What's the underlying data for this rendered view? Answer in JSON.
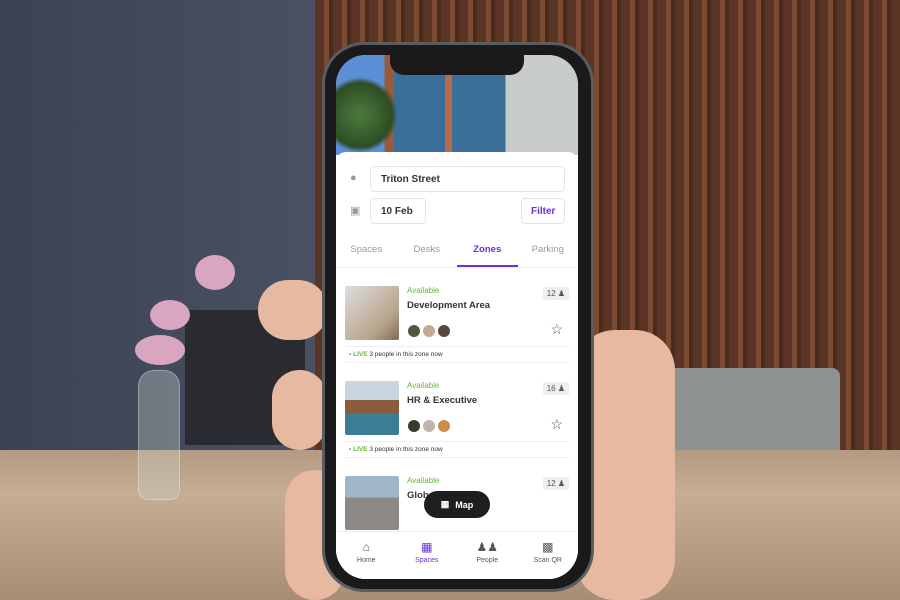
{
  "search": {
    "location": "Triton Street",
    "date": "10 Feb",
    "filter_label": "Filter"
  },
  "tabs": [
    {
      "label": "Spaces"
    },
    {
      "label": "Desks"
    },
    {
      "label": "Zones"
    },
    {
      "label": "Parking"
    }
  ],
  "active_tab": "Zones",
  "zones": [
    {
      "status": "Available",
      "name": "Development Area",
      "capacity": "12",
      "live_label": "LIVE",
      "live_text": "3 people in this zone now"
    },
    {
      "status": "Available",
      "name": "HR & Executive",
      "capacity": "16",
      "live_label": "LIVE",
      "live_text": "3 people in this zone now"
    },
    {
      "status": "Available",
      "name": "Global Teams",
      "capacity": "12"
    }
  ],
  "map_button": "Map",
  "bottom_nav": [
    {
      "label": "Home",
      "icon": "home-icon"
    },
    {
      "label": "Spaces",
      "icon": "building-icon"
    },
    {
      "label": "People",
      "icon": "people-icon"
    },
    {
      "label": "Scan QR",
      "icon": "qr-icon"
    }
  ],
  "colors": {
    "accent": "#6b2fd6",
    "available": "#66b832"
  }
}
